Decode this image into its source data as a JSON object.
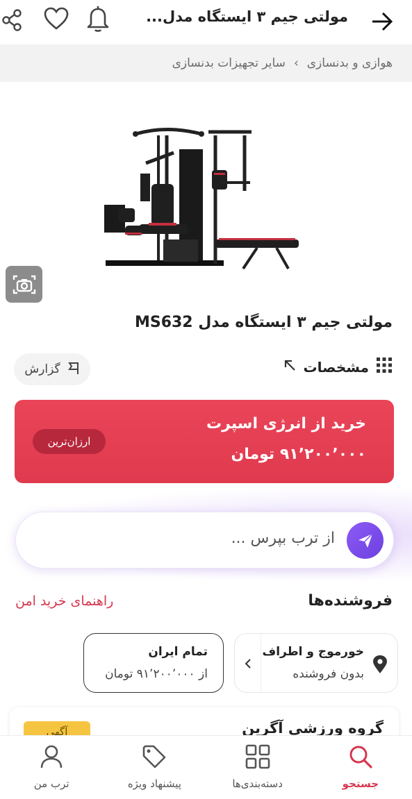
{
  "header": {
    "title": "مولتی جیم ۳ ایستگاه مدل...",
    "icons": [
      "back-arrow-icon",
      "bell-icon",
      "heart-icon",
      "share-icon"
    ]
  },
  "breadcrumb": {
    "items": [
      "هوازی و بدنسازی",
      "سایر تجهیزات بدنسازی"
    ],
    "separator": "›"
  },
  "product": {
    "title": "مولتی جیم ۳ ایستگاه مدل MS632",
    "image_icon": "multi-gym-machine-image",
    "visual_search_icon": "camera-scan-icon"
  },
  "actions": {
    "specs_label": "مشخصات",
    "report_label": "گزارش"
  },
  "buy_card": {
    "title": "خرید از انرژی اسپرت",
    "price": "۹۱٬۲۰۰٬۰۰۰ تومان",
    "badge": "ارزان‌ترین",
    "color": "#e63e52"
  },
  "ask": {
    "placeholder": "از ترب بپرس ..."
  },
  "sellers": {
    "title": "فروشنده‌ها",
    "guide_link": "راهنمای خرید امن",
    "location_chip": {
      "line1": "خورموج و اطراف",
      "line2": "بدون فروشنده"
    },
    "all_chip": {
      "line1": "تمام ایران",
      "line2": "از ۹۱٬۲۰۰٬۰۰۰ تومان"
    },
    "first_card": {
      "name": "گروه ورزشی آگرین",
      "badge": "آگهی"
    }
  },
  "bottom_nav": {
    "items": [
      {
        "label": "جستجو",
        "icon": "search-icon",
        "active": true
      },
      {
        "label": "دسته‌بندی‌ها",
        "icon": "grid-icon",
        "active": false
      },
      {
        "label": "پیشنهاد ویژه",
        "icon": "tag-icon",
        "active": false
      },
      {
        "label": "ترب من",
        "icon": "user-icon",
        "active": false
      }
    ]
  },
  "colors": {
    "accent": "#d6374f",
    "purple": "#7c4dff"
  }
}
